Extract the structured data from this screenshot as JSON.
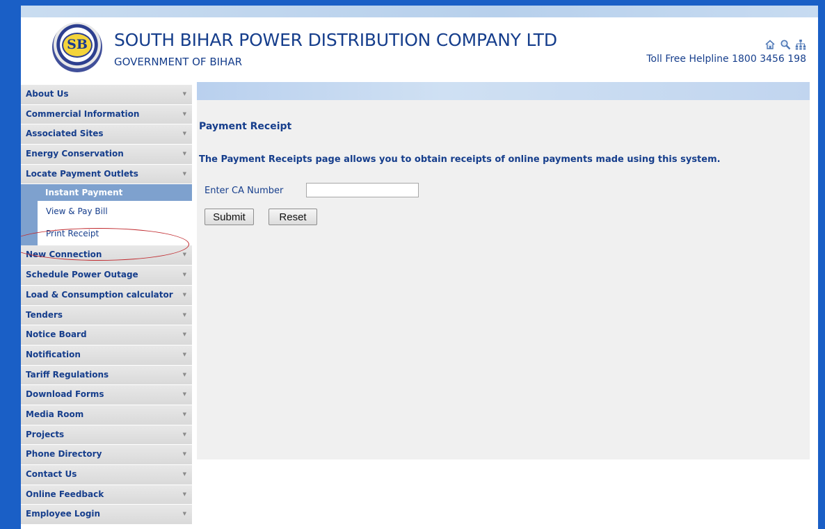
{
  "header": {
    "logo_text": "SB",
    "company_name": "SOUTH BIHAR POWER DISTRIBUTION COMPANY LTD",
    "government": "GOVERNMENT OF BIHAR",
    "helpline": "Toll Free Helpline 1800 3456 198",
    "icons": [
      "home-icon",
      "search-icon",
      "sitemap-icon"
    ]
  },
  "sidebar": {
    "items_before": [
      {
        "label": "About Us"
      },
      {
        "label": "Commercial Information"
      },
      {
        "label": "Associated Sites"
      },
      {
        "label": "Energy Conservation"
      },
      {
        "label": "Locate Payment Outlets"
      }
    ],
    "submenu": {
      "heading": "Instant Payment",
      "links": [
        "View & Pay Bill",
        "Print Receipt"
      ]
    },
    "items_after": [
      {
        "label": "New Connection"
      },
      {
        "label": "Schedule Power Outage"
      },
      {
        "label": "Load & Consumption calculator"
      },
      {
        "label": "Tenders"
      },
      {
        "label": "Notice Board"
      },
      {
        "label": "Notification"
      },
      {
        "label": "Tariff Regulations"
      },
      {
        "label": "Download Forms"
      },
      {
        "label": "Media Room"
      },
      {
        "label": "Projects"
      },
      {
        "label": "Phone Directory"
      },
      {
        "label": "Contact Us"
      },
      {
        "label": "Online Feedback"
      },
      {
        "label": "Employee Login"
      }
    ]
  },
  "main": {
    "title": "Payment Receipt",
    "description": "The Payment Receipts page allows you to obtain receipts of online payments made using this system.",
    "form": {
      "ca_label": "Enter CA Number",
      "ca_value": "",
      "submit_label": "Submit",
      "reset_label": "Reset"
    }
  },
  "colors": {
    "brand_blue": "#163e8c",
    "page_background": "#1a5fc6",
    "menu_highlight": "#7ea1ce",
    "annotation_red": "#c0282d"
  }
}
